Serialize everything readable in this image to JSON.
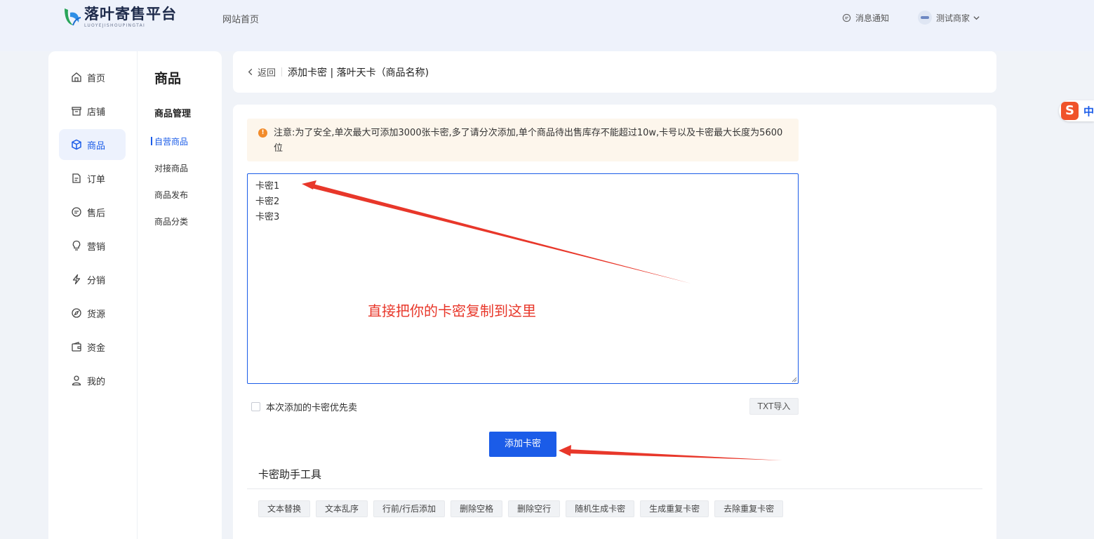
{
  "header": {
    "logo_title": "落叶寄售平台",
    "logo_subtitle": "LUOYEJISHOUPINGTAI",
    "nav_home": "网站首页",
    "notify_label": "消息通知",
    "user_name": "测试商家"
  },
  "sidebar": {
    "items": [
      {
        "label": "首页",
        "icon": "home-icon"
      },
      {
        "label": "店铺",
        "icon": "store-icon"
      },
      {
        "label": "商品",
        "icon": "cube-icon"
      },
      {
        "label": "订单",
        "icon": "order-icon"
      },
      {
        "label": "售后",
        "icon": "chat-icon"
      },
      {
        "label": "营销",
        "icon": "bulb-icon"
      },
      {
        "label": "分销",
        "icon": "bolt-icon"
      },
      {
        "label": "货源",
        "icon": "compass-icon"
      },
      {
        "label": "资金",
        "icon": "wallet-icon"
      },
      {
        "label": "我的",
        "icon": "user-icon"
      }
    ],
    "active_index": 2,
    "sub_title": "商品",
    "sub_group": "商品管理",
    "sub_items": [
      "自营商品",
      "对接商品",
      "商品发布",
      "商品分类"
    ]
  },
  "breadcrumb": {
    "back": "返回",
    "title": "添加卡密 | 落叶天卡（商品名称)"
  },
  "notice": {
    "icon": "!",
    "text": "注意:为了安全,单次最大可添加3000张卡密,多了请分次添加,单个商品待出售库存不能超过10w,卡号以及卡密最大长度为5600位"
  },
  "card_input": {
    "value": "卡密1\n卡密2\n卡密3"
  },
  "annotation": {
    "hint": "直接把你的卡密复制到这里"
  },
  "options": {
    "priority_label": "本次添加的卡密优先卖",
    "priority_checked": false,
    "txt_import": "TXT导入"
  },
  "add_button": "添加卡密",
  "tools": {
    "title": "卡密助手工具",
    "buttons": [
      "文本替换",
      "文本乱序",
      "行前/行后添加",
      "删除空格",
      "删除空行",
      "随机生成卡密",
      "生成重复卡密",
      "去除重复卡密"
    ]
  },
  "ime": {
    "brand": "S",
    "mode": "中"
  },
  "colors": {
    "primary": "#1b5ce8",
    "annotation": "#e8372a",
    "notice_bg": "#fdf6ec",
    "notice_icon": "#f28b2a"
  }
}
